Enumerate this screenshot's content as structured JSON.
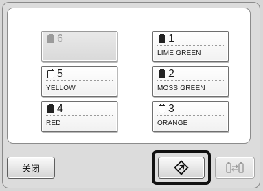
{
  "slots": {
    "s6": {
      "number": "6",
      "color_name": "",
      "state": "empty"
    },
    "s5": {
      "number": "5",
      "color_name": "YELLOW",
      "state": "empty-spool"
    },
    "s4": {
      "number": "4",
      "color_name": "RED",
      "state": "filled-spool"
    },
    "s1": {
      "number": "1",
      "color_name": "LIME GREEN",
      "state": "filled-spool"
    },
    "s2": {
      "number": "2",
      "color_name": "MOSS GREEN",
      "state": "filled-spool"
    },
    "s3": {
      "number": "3",
      "color_name": "ORANGE",
      "state": "empty-spool"
    }
  },
  "buttons": {
    "close_label": "关闭",
    "set_icon": "thread-set-icon",
    "swap_icon": "spool-swap-icon"
  },
  "colors": {
    "panel_bg": "#ffffff",
    "screen_bg": "#dcdcdc",
    "highlight": "#111111"
  }
}
